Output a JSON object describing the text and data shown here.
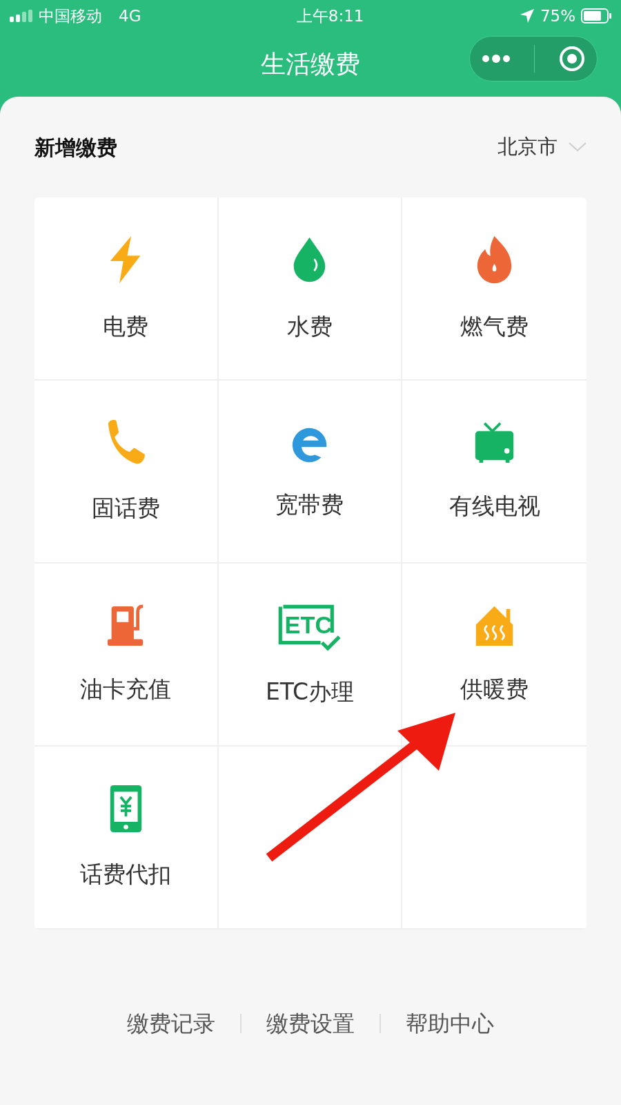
{
  "status_bar": {
    "carrier": "中国移动",
    "network": "4G",
    "time": "上午8:11",
    "battery": "75%"
  },
  "nav_bar": {
    "title": "生活缴费"
  },
  "section": {
    "title": "新增缴费",
    "city": "北京市"
  },
  "services": [
    {
      "label": "电费"
    },
    {
      "label": "水费"
    },
    {
      "label": "燃气费"
    },
    {
      "label": "固话费"
    },
    {
      "label": "宽带费"
    },
    {
      "label": "有线电视"
    },
    {
      "label": "油卡充值"
    },
    {
      "label": "ETC办理",
      "icon_text": "ETC"
    },
    {
      "label": "供暖费"
    },
    {
      "label": "话费代扣"
    }
  ],
  "footer_links": [
    "缴费记录",
    "缴费设置",
    "帮助中心"
  ],
  "annotation": {
    "kind": "arrow"
  }
}
